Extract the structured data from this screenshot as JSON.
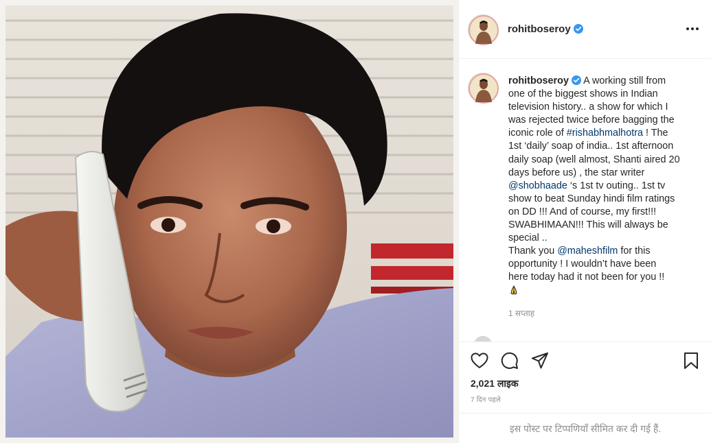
{
  "post": {
    "username": "rohitboseroy",
    "verified": true,
    "caption": {
      "username": "rohitboseroy",
      "segments": {
        "l1": "A working still from",
        "l2": "one of the biggest shows in Indian",
        "l3": "television history.. a show for which I",
        "l4": "was rejected twice before bagging the",
        "l5a": "iconic role of ",
        "hashtag": "#rishabhmalhotra",
        "l5b": " ! The",
        "l6": "1st ‘daily’ soap of india.. 1st afternoon",
        "l7": "daily soap (well almost, Shanti aired 20",
        "l8": "days before us) , the star writer",
        "mention1": "@shobhaade",
        "l9b": " ‘s 1st tv outing.. 1st tv",
        "l10": "show to beat Sunday hindi film ratings",
        "l11": "on DD !!! And of course, my first!!!",
        "l12": "SWABHIMAAN!!! This will always be",
        "l13": "special ..",
        "l14a": "Thank you ",
        "mention2": "@maheshfilm",
        "l14b": " for this",
        "l15": "opportunity ! I wouldn’t have been",
        "l16": "here today had it not been for you !!"
      },
      "time": "1 सप्ताह"
    },
    "likes_count": "2,021",
    "likes_label": "लाइक",
    "posted_ago": "7 दिन पहले",
    "comments_notice": "इस पोस्ट पर टिप्पणियाँ सीमित कर दी गई हैं.",
    "icons": {
      "verified": "verified-badge-icon",
      "more": "more-options-icon",
      "like": "heart-icon",
      "comment": "comment-bubble-icon",
      "share": "paper-plane-icon",
      "save": "bookmark-icon",
      "caption_emoji": "folded-hands-emoji-icon"
    },
    "colors": {
      "verified": "#3897f0",
      "link": "#00376b",
      "muted": "#8e8e8e",
      "text": "#262626",
      "border": "#efefef"
    }
  }
}
